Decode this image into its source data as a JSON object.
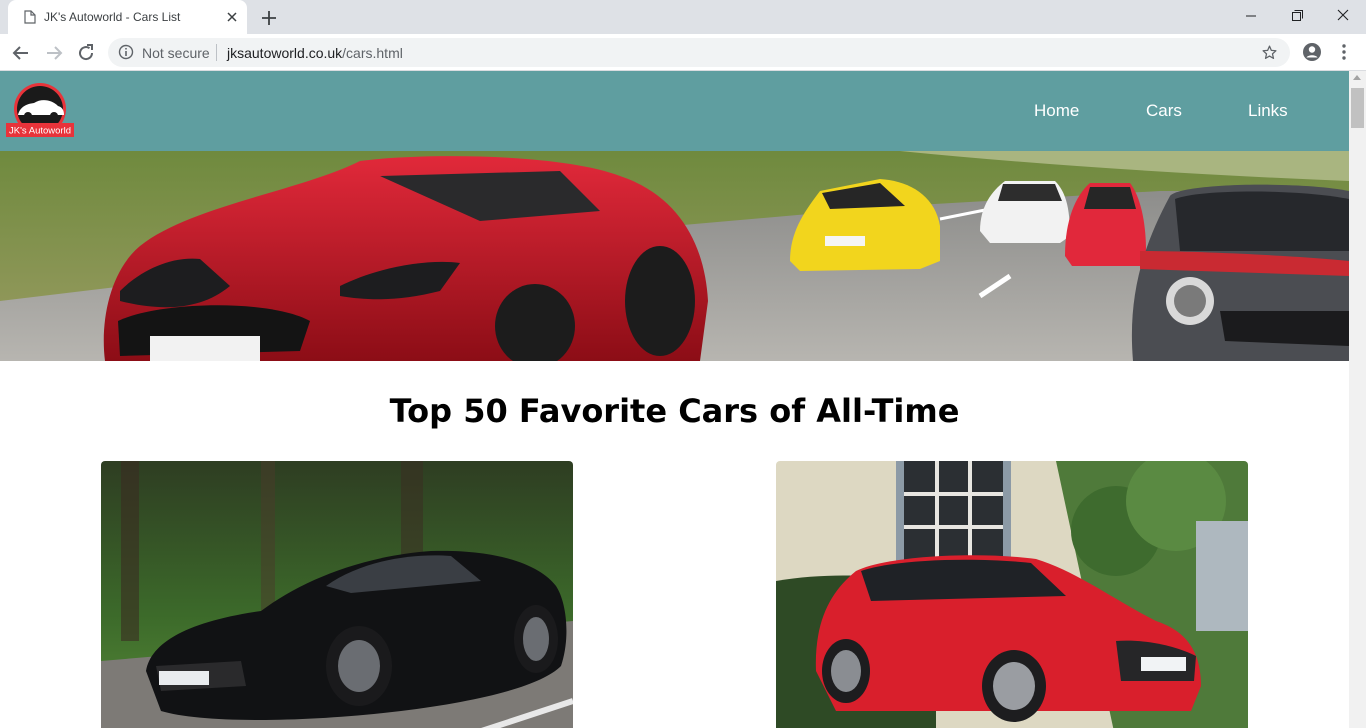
{
  "browser": {
    "tab_title": "JK's Autoworld - Cars List",
    "security_label": "Not secure",
    "url_domain": "jksautoworld.co.uk",
    "url_path": "/cars.html"
  },
  "site": {
    "logo_text": "JK's Autoworld",
    "nav": [
      {
        "label": "Home"
      },
      {
        "label": "Cars"
      },
      {
        "label": "Links"
      }
    ],
    "page_title": "Top 50 Favorite Cars of All-Time"
  },
  "colors": {
    "header_bg": "#5f9ea0",
    "logo_red": "#e8333a",
    "tabstrip_bg": "#dee1e6"
  },
  "icons": [
    "page-icon",
    "close-icon",
    "plus-icon",
    "minimize-icon",
    "maximize-icon",
    "window-close-icon",
    "back-arrow-icon",
    "forward-arrow-icon",
    "reload-icon",
    "info-icon",
    "star-icon",
    "profile-icon",
    "kebab-menu-icon"
  ]
}
